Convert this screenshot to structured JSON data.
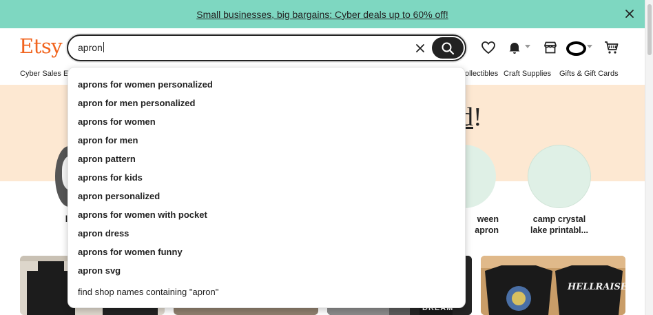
{
  "promo": {
    "text": "Small businesses, big bargains: Cyber deals up to 60% off!"
  },
  "header": {
    "logo": "Etsy",
    "search_value": "apron"
  },
  "nav": {
    "items": [
      "Cyber Sales E",
      "ollectibles",
      "Craft Supplies",
      "Gifts & Gift Cards"
    ]
  },
  "hero": {
    "title_visible": "d",
    "title_suffix": "!"
  },
  "circles": [
    {
      "label": "le"
    },
    {
      "label_line1": "ween",
      "label_line2": "apron"
    },
    {
      "label_line1": "camp crystal",
      "label_line2": "lake printabl..."
    }
  ],
  "suggestions": [
    "aprons for women personalized",
    "apron for men personalized",
    "aprons for women",
    "apron for men",
    "apron pattern",
    "aprons for kids",
    "apron personalized",
    "aprons for women with pocket",
    "apron dress",
    "aprons for women funny",
    "apron svg"
  ],
  "shop_search": "find shop names containing \"apron\"",
  "cards": {
    "card3_text": "DREAM",
    "card4_text": "HELLRAISER"
  },
  "colors": {
    "promo_bg": "#7ed7c1",
    "brand": "#f1641e",
    "hero_bg": "#fde8d2",
    "circle_bg": "#dff0e6"
  },
  "icons": [
    "close-icon",
    "clear-icon",
    "search-icon",
    "heart-icon",
    "bell-icon",
    "shop-icon",
    "cart-icon",
    "chevron-down-icon"
  ]
}
